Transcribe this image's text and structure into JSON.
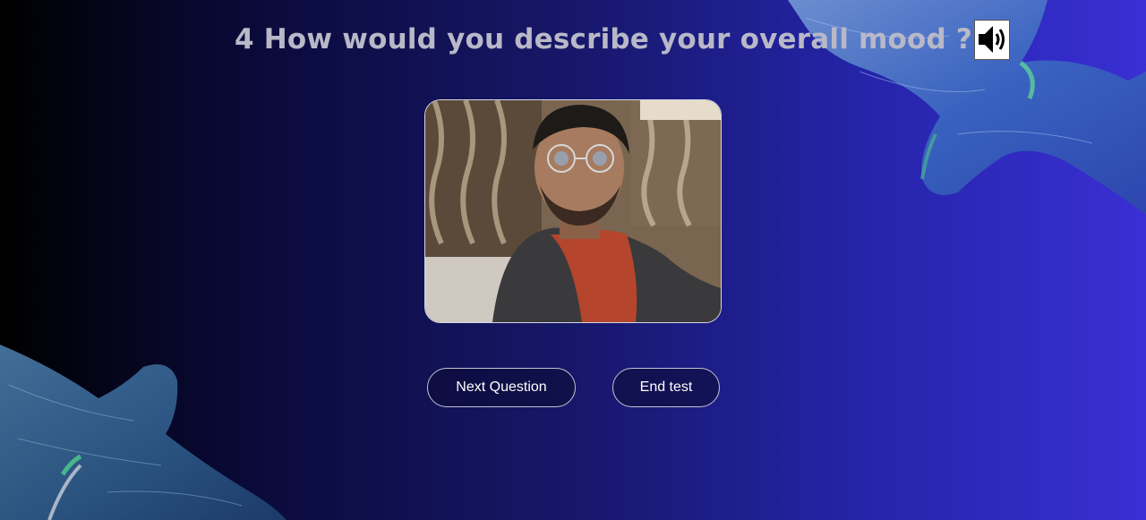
{
  "question": {
    "number": "4",
    "text": "How would you describe your overall mood ?",
    "speaker_icon": "speaker-volume-icon"
  },
  "webcam": {
    "label": "webcam-feed"
  },
  "buttons": {
    "next_label": "Next Question",
    "end_label": "End test"
  },
  "colors": {
    "background_left": "#000000",
    "background_right": "#3a2fd4",
    "question_text": "#b8b8c8",
    "button_border": "#c3c3d3"
  }
}
